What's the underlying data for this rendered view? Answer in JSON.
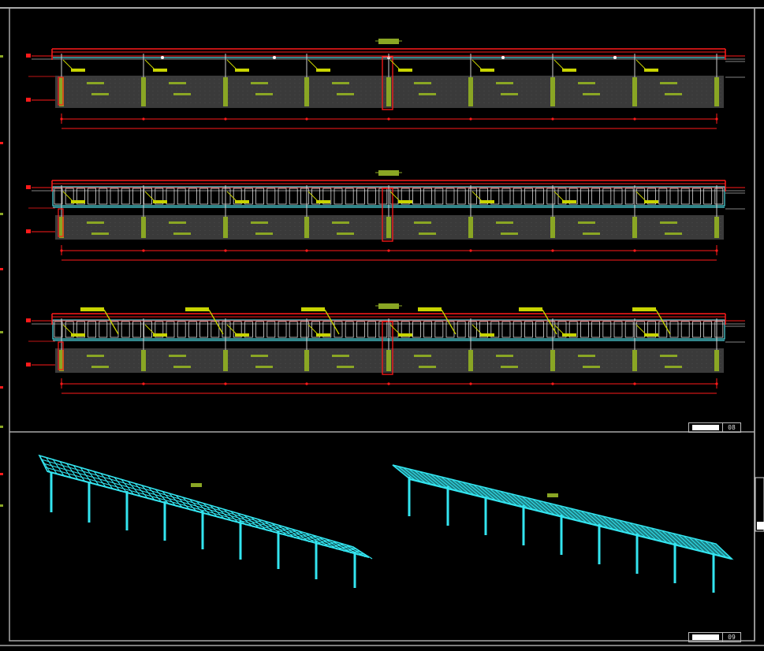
{
  "sheets": [
    {
      "number": "08"
    },
    {
      "number": "09"
    }
  ],
  "colors": {
    "background": "#000000",
    "frame": "#a8a8a8",
    "structure": "#ff1a1a",
    "rafter": "#4fd8e0",
    "column": "#8aa624",
    "annotation": "#c8d400",
    "panel": "#3a3a3a",
    "model": "#33e5f0"
  },
  "elevations": [
    {
      "view": "elevation-a",
      "style": "plain"
    },
    {
      "view": "elevation-b",
      "style": "gridded"
    },
    {
      "view": "elevation-c",
      "style": "gridded-annotated"
    }
  ],
  "isometric_views": [
    {
      "view": "iso-lattice",
      "style": "lattice"
    },
    {
      "view": "iso-solid",
      "style": "solid"
    }
  ]
}
